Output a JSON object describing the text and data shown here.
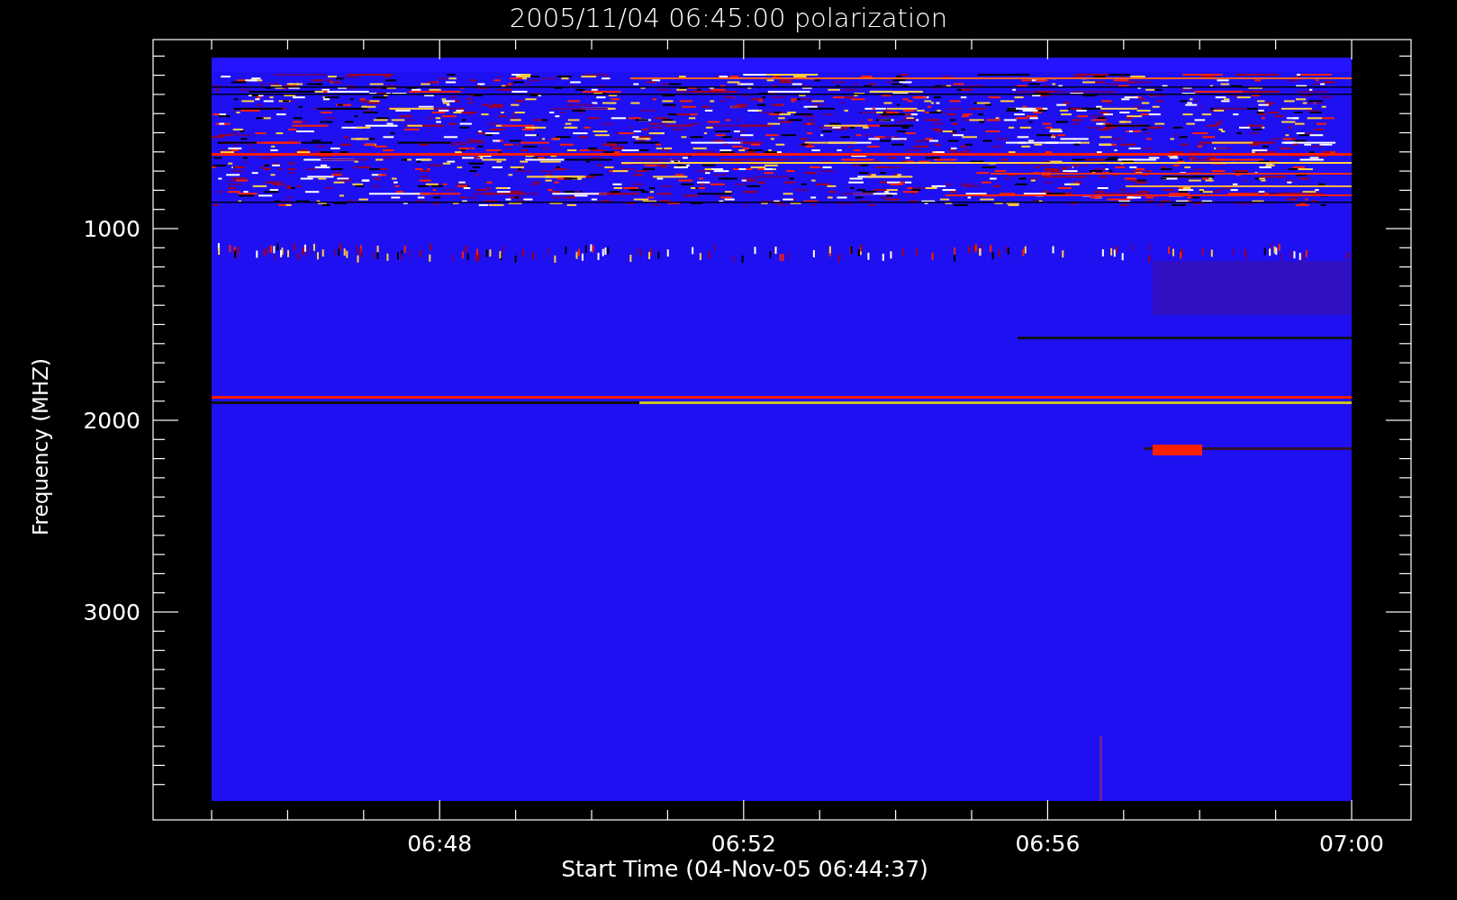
{
  "title": "2005/11/04 06:45:00 polarization",
  "y_axis": {
    "label": "Frequency (MHZ)",
    "ticks": [
      "1000",
      "2000",
      "3000"
    ]
  },
  "x_axis": {
    "label": "Start Time (04-Nov-05 06:44:37)",
    "ticks": [
      "06:48",
      "06:52",
      "06:56",
      "07:00"
    ]
  }
}
